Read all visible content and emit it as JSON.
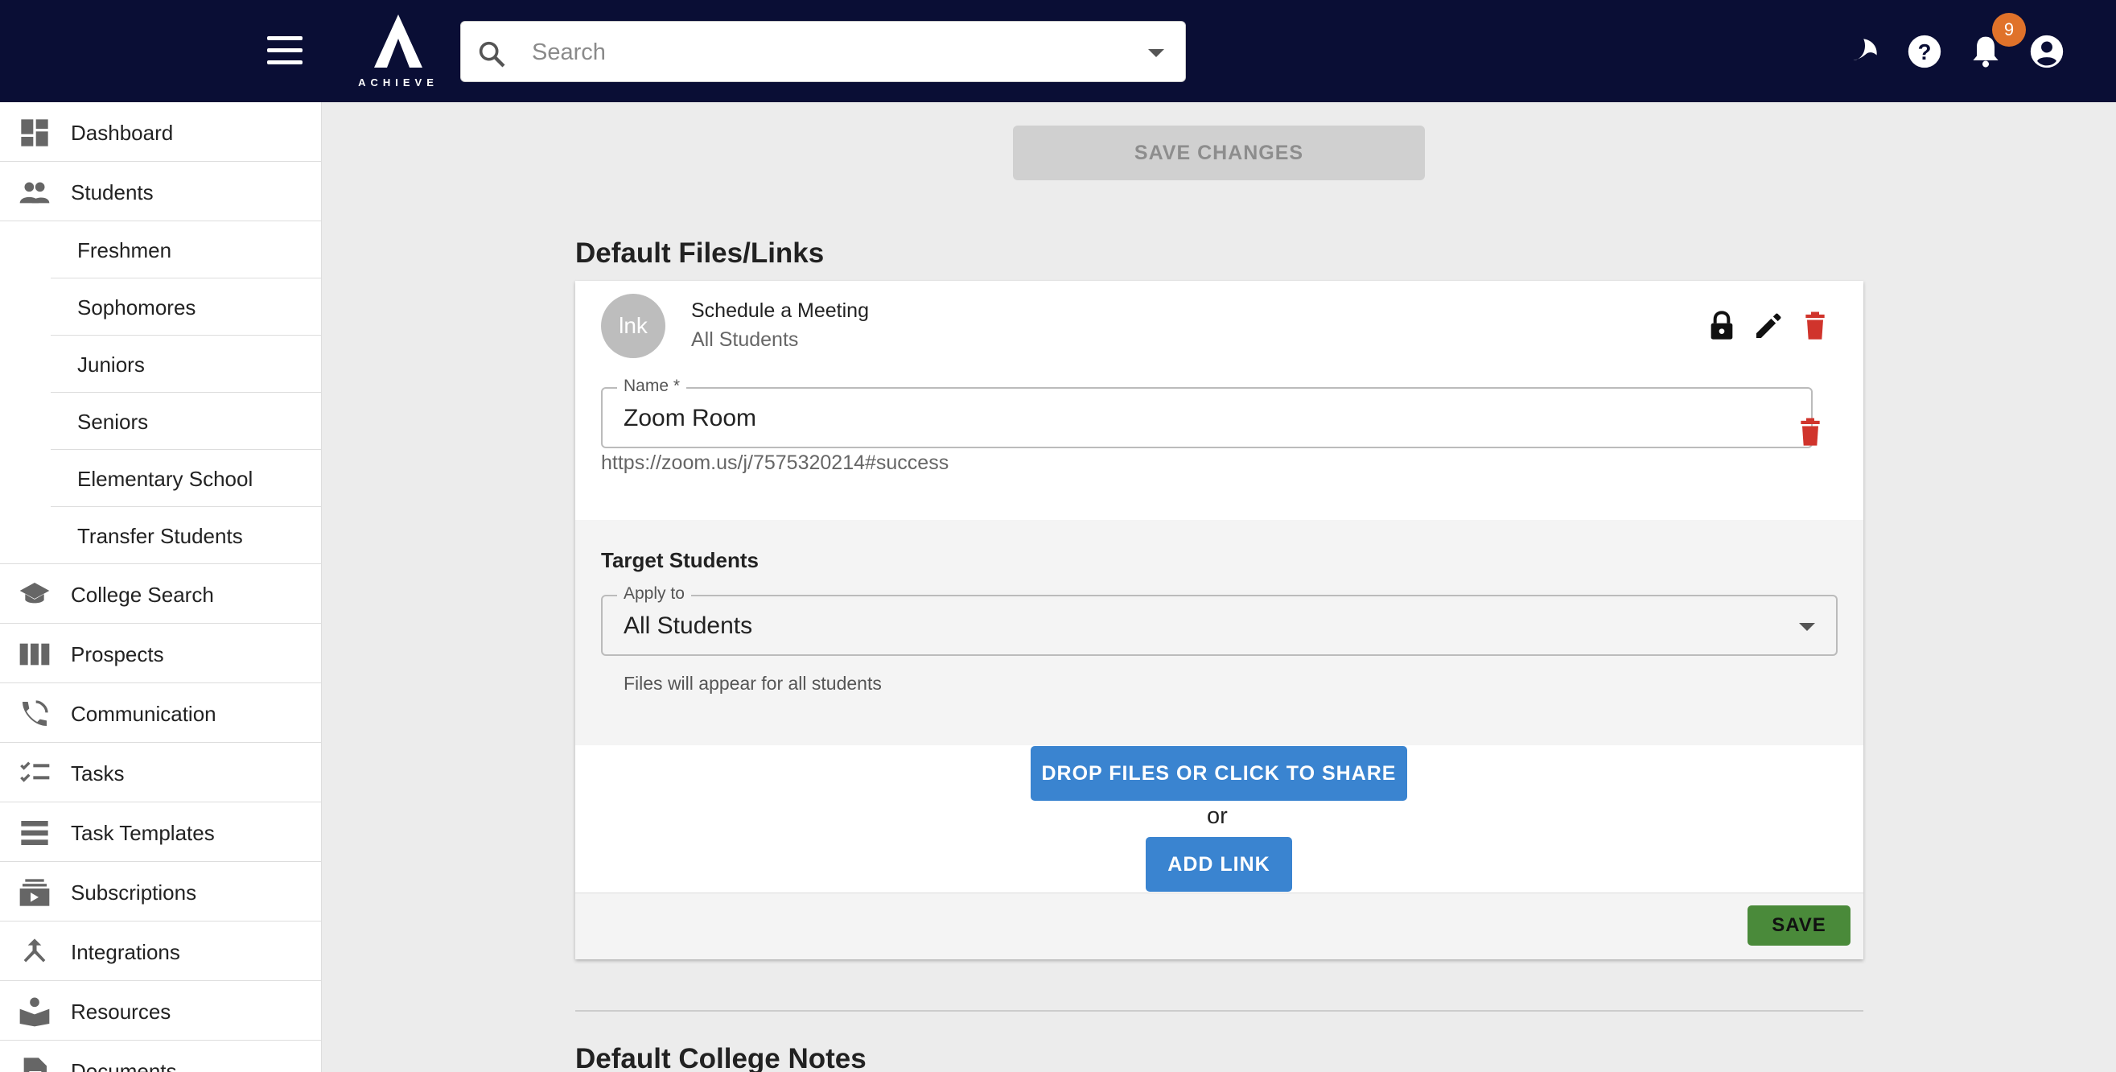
{
  "header": {
    "logo_text": "ACHIEVE",
    "search_placeholder": "Search",
    "notification_count": "9"
  },
  "sidebar": {
    "items": [
      {
        "label": "Dashboard",
        "icon": "dashboard-icon"
      },
      {
        "label": "Students",
        "icon": "students-icon"
      },
      {
        "label": "College Search",
        "icon": "graduation-cap-icon"
      },
      {
        "label": "Prospects",
        "icon": "columns-icon"
      },
      {
        "label": "Communication",
        "icon": "communication-icon"
      },
      {
        "label": "Tasks",
        "icon": "checklist-icon"
      },
      {
        "label": "Task Templates",
        "icon": "list-icon"
      },
      {
        "label": "Subscriptions",
        "icon": "subscriptions-icon"
      },
      {
        "label": "Integrations",
        "icon": "merge-icon"
      },
      {
        "label": "Resources",
        "icon": "book-icon"
      },
      {
        "label": "Documents",
        "icon": "document-icon"
      }
    ],
    "student_subitems": [
      "Freshmen",
      "Sophomores",
      "Juniors",
      "Seniors",
      "Elementary School",
      "Transfer Students"
    ]
  },
  "main": {
    "save_changes_label": "SAVE CHANGES",
    "default_files_title": "Default Files/Links",
    "card": {
      "avatar_text": "lnk",
      "title": "Schedule a Meeting",
      "subtitle": "All Students",
      "name_label": "Name *",
      "name_value": "Zoom Room",
      "url": "https://zoom.us/j/7575320214#success",
      "target_title": "Target Students",
      "apply_label": "Apply to",
      "apply_value": "All Students",
      "helper_text": "Files will appear for all students",
      "drop_files_label": "DROP FILES OR CLICK TO SHARE",
      "or_text": "or",
      "add_link_label": "ADD LINK",
      "save_label": "SAVE"
    },
    "default_college_notes_title": "Default College Notes"
  },
  "colors": {
    "topbar": "#0a0e35",
    "primary_button": "#3a84d0",
    "save_button": "#4a8a3a",
    "delete_icon": "#d0342c",
    "badge": "#e0722a"
  }
}
